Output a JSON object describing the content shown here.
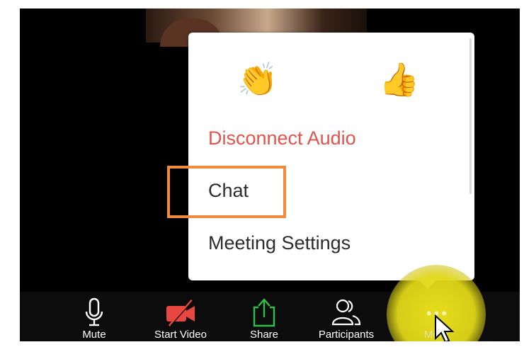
{
  "popup_menu": {
    "reactions": [
      {
        "icon": "clapping-hands-icon",
        "glyph": "👏"
      },
      {
        "icon": "thumbs-up-icon",
        "glyph": "👍"
      }
    ],
    "items": [
      {
        "label": "Disconnect Audio",
        "color": "#e0544d"
      },
      {
        "label": "Chat",
        "highlighted": true
      },
      {
        "label": "Meeting Settings"
      }
    ]
  },
  "toolbar": {
    "buttons": [
      {
        "label": "Mute",
        "icon": "microphone-icon"
      },
      {
        "label": "Start Video",
        "icon": "video-off-icon",
        "color": "#e8473f"
      },
      {
        "label": "Share",
        "icon": "share-icon",
        "color": "#2fbf4c"
      },
      {
        "label": "Participants",
        "icon": "participants-icon"
      },
      {
        "label": "More",
        "icon": "more-dots-icon"
      }
    ]
  },
  "colors": {
    "highlight_box": "#f08a3c",
    "more_glow": "#e6dc1e",
    "disconnect_text": "#e0544d"
  }
}
